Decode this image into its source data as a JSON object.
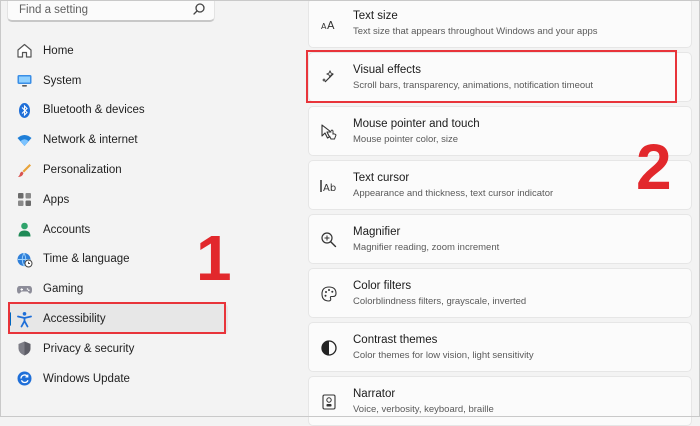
{
  "search": {
    "placeholder": "Find a setting"
  },
  "sidebar": {
    "items": [
      {
        "label": "Home"
      },
      {
        "label": "System"
      },
      {
        "label": "Bluetooth & devices"
      },
      {
        "label": "Network & internet"
      },
      {
        "label": "Personalization"
      },
      {
        "label": "Apps"
      },
      {
        "label": "Accounts"
      },
      {
        "label": "Time & language"
      },
      {
        "label": "Gaming"
      },
      {
        "label": "Accessibility",
        "selected": true
      },
      {
        "label": "Privacy & security"
      },
      {
        "label": "Windows Update"
      }
    ]
  },
  "annotations": {
    "step1": "1",
    "step2": "2"
  },
  "content": {
    "cards": [
      {
        "title": "Text size",
        "subtitle": "Text size that appears throughout Windows and your apps"
      },
      {
        "title": "Visual effects",
        "subtitle": "Scroll bars, transparency, animations, notification timeout"
      },
      {
        "title": "Mouse pointer and touch",
        "subtitle": "Mouse pointer color, size"
      },
      {
        "title": "Text cursor",
        "subtitle": "Appearance and thickness, text cursor indicator"
      },
      {
        "title": "Magnifier",
        "subtitle": "Magnifier reading, zoom increment"
      },
      {
        "title": "Color filters",
        "subtitle": "Colorblindness filters, grayscale, inverted"
      },
      {
        "title": "Contrast themes",
        "subtitle": "Color themes for low vision, light sensitivity"
      },
      {
        "title": "Narrator",
        "subtitle": "Voice, verbosity, keyboard, braille"
      }
    ]
  },
  "colors": {
    "accent": "#0067c0",
    "highlight": "#e8343a"
  }
}
